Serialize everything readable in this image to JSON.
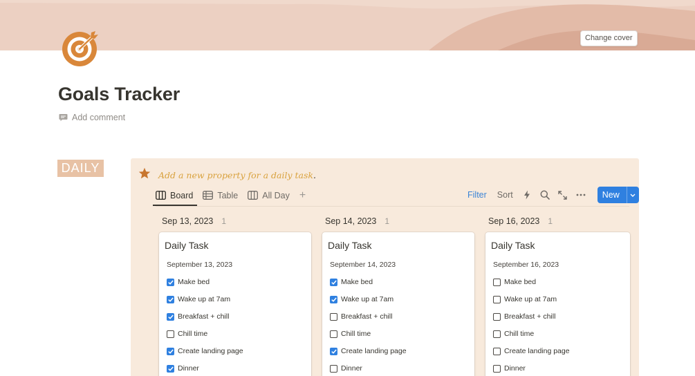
{
  "cover": {
    "change_cover_label": "Change cover"
  },
  "page": {
    "title": "Goals Tracker",
    "add_comment": "Add comment"
  },
  "section_badge": "DAILY",
  "callout": {
    "text": "Add a new property for a daily task",
    "trailing": "."
  },
  "view_tabs": [
    {
      "label": "Board",
      "icon": "board-icon",
      "active": true
    },
    {
      "label": "Table",
      "icon": "table-icon",
      "active": false
    },
    {
      "label": "All Day",
      "icon": "calendar-icon",
      "active": false
    }
  ],
  "toolbar": {
    "filter": "Filter",
    "sort": "Sort",
    "new": "New"
  },
  "colors": {
    "accent": "#2f80e0",
    "callout_bg": "#f8eadc",
    "badge_bg": "#e8c2a5",
    "callout_text": "#d9a23e",
    "icon_orange": "#d9873a"
  },
  "columns": [
    {
      "date": "Sep 13, 2023",
      "count": "1",
      "card": {
        "title": "Daily Task",
        "date": "September 13, 2023",
        "tasks": [
          {
            "label": "Make bed",
            "checked": true
          },
          {
            "label": "Wake up at 7am",
            "checked": true
          },
          {
            "label": "Breakfast + chill",
            "checked": true
          },
          {
            "label": "Chill time",
            "checked": false
          },
          {
            "label": "Create landing page",
            "checked": true
          },
          {
            "label": "Dinner",
            "checked": true
          }
        ]
      }
    },
    {
      "date": "Sep 14, 2023",
      "count": "1",
      "card": {
        "title": "Daily Task",
        "date": "September 14, 2023",
        "tasks": [
          {
            "label": "Make bed",
            "checked": true
          },
          {
            "label": "Wake up at 7am",
            "checked": true
          },
          {
            "label": "Breakfast + chill",
            "checked": false
          },
          {
            "label": "Chill time",
            "checked": false
          },
          {
            "label": "Create landing page",
            "checked": true
          },
          {
            "label": "Dinner",
            "checked": false
          }
        ]
      }
    },
    {
      "date": "Sep 16, 2023",
      "count": "1",
      "card": {
        "title": "Daily Task",
        "date": "September 16, 2023",
        "tasks": [
          {
            "label": "Make bed",
            "checked": false
          },
          {
            "label": "Wake up at 7am",
            "checked": false
          },
          {
            "label": "Breakfast + chill",
            "checked": false
          },
          {
            "label": "Chill time",
            "checked": false
          },
          {
            "label": "Create landing page",
            "checked": false
          },
          {
            "label": "Dinner",
            "checked": false
          }
        ]
      }
    }
  ]
}
